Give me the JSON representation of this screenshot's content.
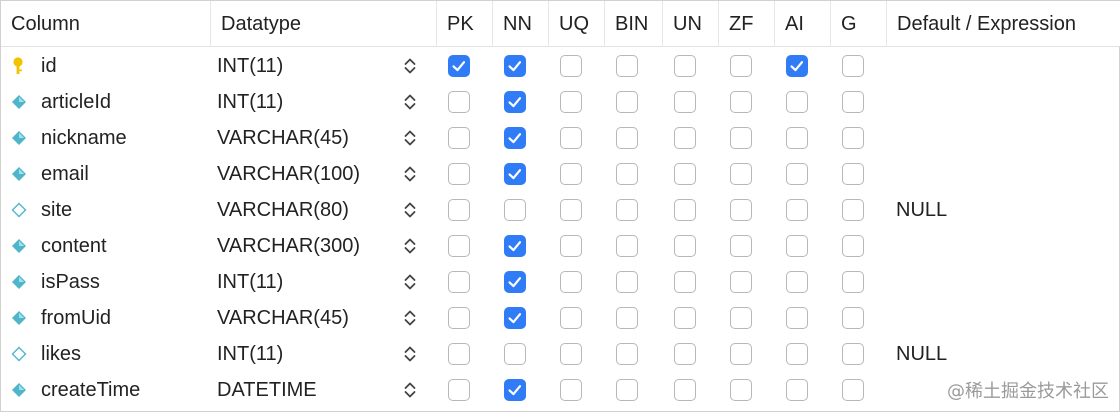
{
  "header": {
    "column": "Column",
    "datatype": "Datatype",
    "pk": "PK",
    "nn": "NN",
    "uq": "UQ",
    "bin": "BIN",
    "un": "UN",
    "zf": "ZF",
    "ai": "AI",
    "g": "G",
    "default": "Default / Expression"
  },
  "colors": {
    "checked": "#2f7cf6",
    "key_primary": "#f2c200",
    "key_nn": "#4fb6c9",
    "key_nullable_outline": "#4fb6c9"
  },
  "rows": [
    {
      "name": "id",
      "datatype": "INT(11)",
      "icon": "primary-key-icon",
      "flags": {
        "pk": true,
        "nn": true,
        "uq": false,
        "bin": false,
        "un": false,
        "zf": false,
        "ai": true,
        "g": false
      },
      "default": ""
    },
    {
      "name": "articleId",
      "datatype": "INT(11)",
      "icon": "not-null-diamond-icon",
      "flags": {
        "pk": false,
        "nn": true,
        "uq": false,
        "bin": false,
        "un": false,
        "zf": false,
        "ai": false,
        "g": false
      },
      "default": ""
    },
    {
      "name": "nickname",
      "datatype": "VARCHAR(45)",
      "icon": "not-null-diamond-icon",
      "flags": {
        "pk": false,
        "nn": true,
        "uq": false,
        "bin": false,
        "un": false,
        "zf": false,
        "ai": false,
        "g": false
      },
      "default": ""
    },
    {
      "name": "email",
      "datatype": "VARCHAR(100)",
      "icon": "not-null-diamond-icon",
      "flags": {
        "pk": false,
        "nn": true,
        "uq": false,
        "bin": false,
        "un": false,
        "zf": false,
        "ai": false,
        "g": false
      },
      "default": ""
    },
    {
      "name": "site",
      "datatype": "VARCHAR(80)",
      "icon": "nullable-diamond-icon",
      "flags": {
        "pk": false,
        "nn": false,
        "uq": false,
        "bin": false,
        "un": false,
        "zf": false,
        "ai": false,
        "g": false
      },
      "default": "NULL"
    },
    {
      "name": "content",
      "datatype": "VARCHAR(300)",
      "icon": "not-null-diamond-icon",
      "flags": {
        "pk": false,
        "nn": true,
        "uq": false,
        "bin": false,
        "un": false,
        "zf": false,
        "ai": false,
        "g": false
      },
      "default": ""
    },
    {
      "name": "isPass",
      "datatype": "INT(11)",
      "icon": "not-null-diamond-icon",
      "flags": {
        "pk": false,
        "nn": true,
        "uq": false,
        "bin": false,
        "un": false,
        "zf": false,
        "ai": false,
        "g": false
      },
      "default": ""
    },
    {
      "name": "fromUid",
      "datatype": "VARCHAR(45)",
      "icon": "not-null-diamond-icon",
      "flags": {
        "pk": false,
        "nn": true,
        "uq": false,
        "bin": false,
        "un": false,
        "zf": false,
        "ai": false,
        "g": false
      },
      "default": ""
    },
    {
      "name": "likes",
      "datatype": "INT(11)",
      "icon": "nullable-diamond-icon",
      "flags": {
        "pk": false,
        "nn": false,
        "uq": false,
        "bin": false,
        "un": false,
        "zf": false,
        "ai": false,
        "g": false
      },
      "default": "NULL"
    },
    {
      "name": "createTime",
      "datatype": "DATETIME",
      "icon": "not-null-diamond-icon",
      "flags": {
        "pk": false,
        "nn": true,
        "uq": false,
        "bin": false,
        "un": false,
        "zf": false,
        "ai": false,
        "g": false
      },
      "default": ""
    }
  ],
  "watermark": "@稀土掘金技术社区"
}
